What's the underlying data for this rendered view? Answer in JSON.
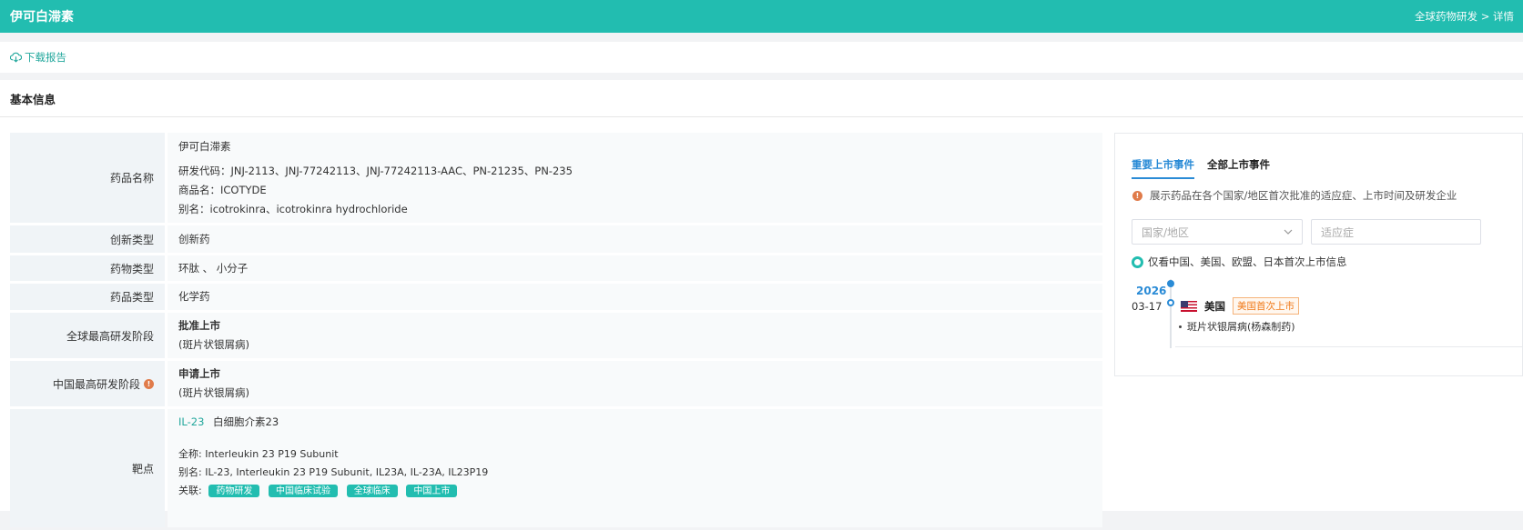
{
  "header": {
    "title": "伊可白滞素",
    "breadcrumb": "全球药物研发 > 详情"
  },
  "actions": {
    "download_label": "下载报告"
  },
  "section": {
    "title": "基本信息"
  },
  "info": {
    "drug_name_label": "药品名称",
    "drug_name": "伊可白滞素",
    "rd_code": "研发代码：JNJ-2113、JNJ-77242113、JNJ-77242113-AAC、PN-21235、PN-235",
    "trade_name": "商品名：ICOTYDE",
    "alias": "别名：icotrokinra、icotrokinra hydrochloride",
    "innovation_label": "创新类型",
    "innovation": "创新药",
    "substance_label": "药物类型",
    "substance": "环肽 、 小分子",
    "category_label": "药品类型",
    "category": "化学药",
    "global_stage_label": "全球最高研发阶段",
    "global_stage": "批准上市",
    "global_stage_note": "(斑片状银屑病)",
    "china_stage_label": "中国最高研发阶段",
    "china_stage": "申请上市",
    "china_stage_note": "(斑片状银屑病)",
    "target_label": "靶点",
    "target_code": "IL-23",
    "target_name": "白细胞介素23",
    "target_fullname": "全称:  Interleukin 23 P19 Subunit",
    "target_alias": "别名:  IL-23, Interleukin 23 P19 Subunit, IL23A, IL-23A, IL23P19",
    "target_tags_label": "关联:",
    "target_tags": [
      "药物研发",
      "中国临床试验",
      "全球临床",
      "中国上市"
    ]
  },
  "panel": {
    "tab_active": "重要上市事件",
    "tab_other": "全部上市事件",
    "notice": "展示药品在各个国家/地区首次批准的适应症、上市时间及研发企业",
    "select_placeholder": "国家/地区",
    "input_placeholder": "适应症",
    "checkbox_label": "仅看中国、美国、欧盟、日本首次上市信息",
    "year": "2026",
    "date": "03-17",
    "country": "美国",
    "badge": "美国首次上市",
    "indication": "斑片状银屑病(杨森制药)"
  }
}
